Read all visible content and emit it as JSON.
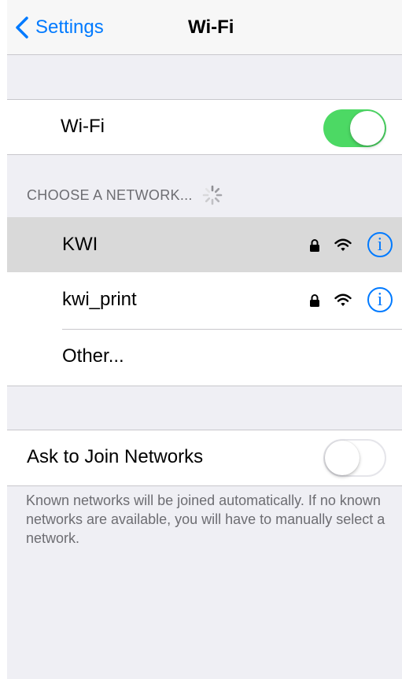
{
  "nav": {
    "back_label": "Settings",
    "title": "Wi-Fi"
  },
  "wifi_toggle": {
    "label": "Wi-Fi",
    "state": "on"
  },
  "section_header": "CHOOSE A NETWORK...",
  "networks": [
    {
      "name": "KWI",
      "secured": true,
      "selected": true,
      "info": "i"
    },
    {
      "name": "kwi_print",
      "secured": true,
      "selected": false,
      "info": "i"
    }
  ],
  "other_label": "Other...",
  "ask_to_join": {
    "label": "Ask to Join Networks",
    "state": "off"
  },
  "footer": "Known networks will be joined automatically. If no known networks are available, you will have to manually select a network.",
  "colors": {
    "accent": "#007aff",
    "toggle_on": "#4cd964",
    "background": "#efeff4",
    "selected_row": "#d9d9d9",
    "secondary_text": "#6d6d72"
  },
  "icons": [
    "chevron-left-icon",
    "spinner-icon",
    "lock-icon",
    "wifi-icon",
    "info-icon"
  ]
}
